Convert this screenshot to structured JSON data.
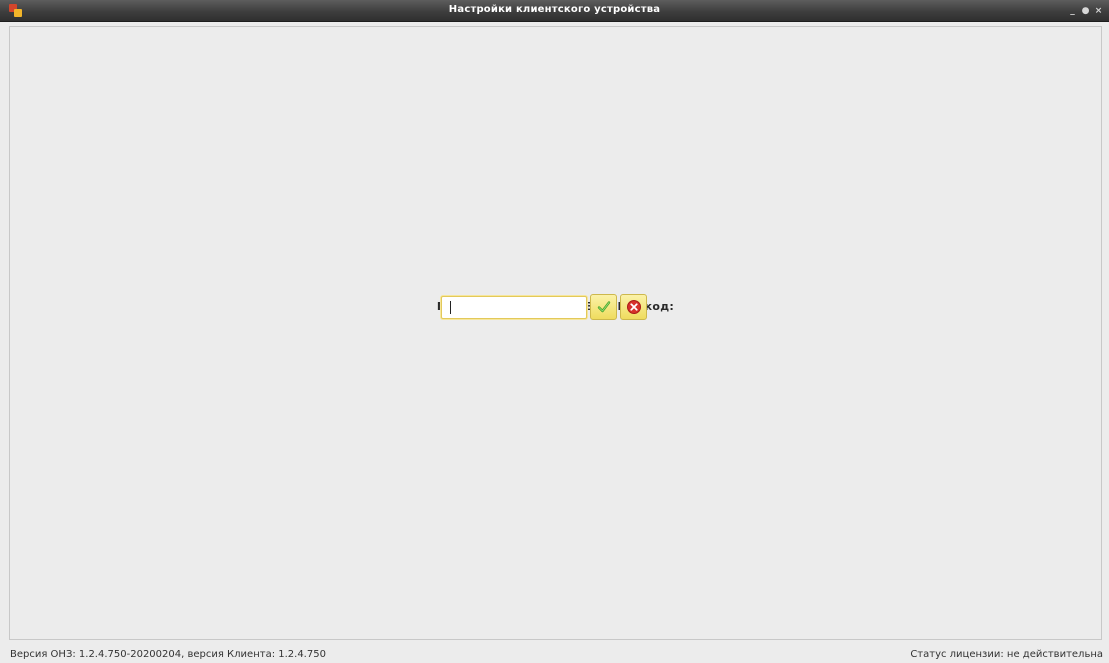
{
  "window": {
    "title": "Настройки клиентского устройства",
    "controls": {
      "minimize": "_",
      "maximize": "●",
      "close": "×"
    }
  },
  "pin_dialog": {
    "prompt": "Пожалуйста, введите Ваш PIN-код:",
    "input_value": "",
    "confirm_icon": "checkmark-icon",
    "cancel_icon": "cancel-icon"
  },
  "footer": {
    "version_text": "Версия ОНЗ: 1.2.4.750-20200204, версия Клиента: 1.2.4.750",
    "license_status": "Статус лицензии: не действительна"
  },
  "colors": {
    "titlebar": "#3e3e3e",
    "background": "#ececec",
    "button_yellow": "#f3e37a",
    "confirm_green": "#3a9b1e",
    "cancel_red": "#d7312a"
  }
}
